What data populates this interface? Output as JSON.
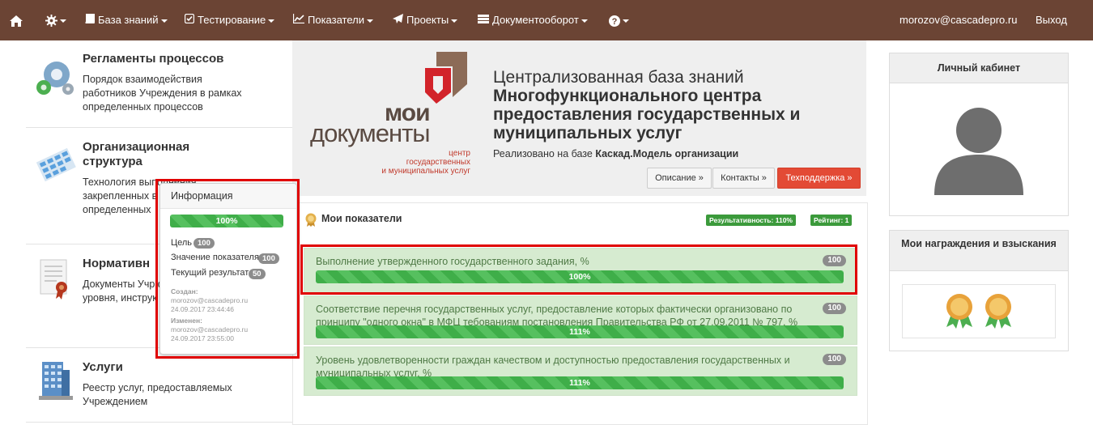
{
  "nav": {
    "home_icon": "home-icon",
    "settings_icon": "gear-icon",
    "items": [
      {
        "label": "База знаний",
        "icon": "book-icon"
      },
      {
        "label": "Тестирование",
        "icon": "check-square-icon"
      },
      {
        "label": "Показатели",
        "icon": "line-chart-icon"
      },
      {
        "label": "Проекты",
        "icon": "paper-plane-icon"
      },
      {
        "label": "Документооборот",
        "icon": "hdd-icon"
      }
    ],
    "help_icon": "question-circle-icon",
    "user_email": "morozov@cascadepro.ru",
    "logout_label": "Выход"
  },
  "left_items": [
    {
      "title": "Регламенты процессов",
      "desc": "Порядок взаимодействия работников Учреждения в рамках определенных процессов",
      "icon": "gears-icon"
    },
    {
      "title": "Организационная структура",
      "desc": "Технология выполнения закрепленных в должностных определенных",
      "icon": "org-structure-icon"
    },
    {
      "title": "Нормативн",
      "desc": "Документы Учр федерального и уровня, инструк информационн",
      "icon": "certificate-document-icon"
    },
    {
      "title": "Услуги",
      "desc": "Реестр услуг, предоставляемых Учреждением",
      "icon": "building-icon"
    }
  ],
  "hero": {
    "logo_text_1": "мои",
    "logo_text_2": "документы",
    "logo_sub": [
      "центр",
      "государственных",
      "и муниципальных услуг"
    ],
    "title_line1": "Централизованная база знаний",
    "title_line2": "Многофункционального центра предоставления государственных и муниципальных услуг",
    "sub_prefix": "Реализовано на базе ",
    "sub_bold": "Каскад.Модель организации",
    "btn_description": "Описание »",
    "btn_contacts": "Контакты »",
    "btn_support": "Техподдержка »"
  },
  "indicators": {
    "title": "Мои показатели",
    "badge_performance": "Результативность: 110%",
    "badge_rating": "Рейтинг: 1",
    "rows": [
      {
        "text": "Выполнение утвержденного государственного задания, %",
        "target": "100",
        "progress": "100%"
      },
      {
        "text": "Соответствие перечня государственных услуг, предоставление которых фактически организовано по принципу \"одного окна\" в МФЦ тебованиям постановления Правительства РФ от 27.09.2011 № 797, %",
        "target": "100",
        "progress": "111%"
      },
      {
        "text": "Уровень удовлетворенности граждан качеством и доступностью предоставления государственных и муниципальных услуг, %",
        "target": "100",
        "progress": "111%"
      }
    ]
  },
  "popover": {
    "title": "Информация",
    "progress": "100%",
    "goal_label": "Цель",
    "goal_value": "100",
    "indicator_label": "Значение показателя",
    "indicator_value": "100",
    "current_label": "Текущий результат",
    "current_value": "50",
    "created_label": "Создан:",
    "created_user": "morozov@cascadepro.ru",
    "created_date": "24.09.2017 23:44:46",
    "changed_label": "Изменен:",
    "changed_user": "morozov@cascadepro.ru",
    "changed_date": "24.09.2017 23:55:00"
  },
  "right": {
    "cabinet_title": "Личный кабинет",
    "awards_title": "Мои награждения и взыскания"
  },
  "colors": {
    "navbar": "#6b4434",
    "progress_green": "#3fae49",
    "highlight_red": "#e00000",
    "support_red": "#e34a35",
    "logo_brown": "#8c6b57",
    "logo_red": "#d2232a"
  }
}
